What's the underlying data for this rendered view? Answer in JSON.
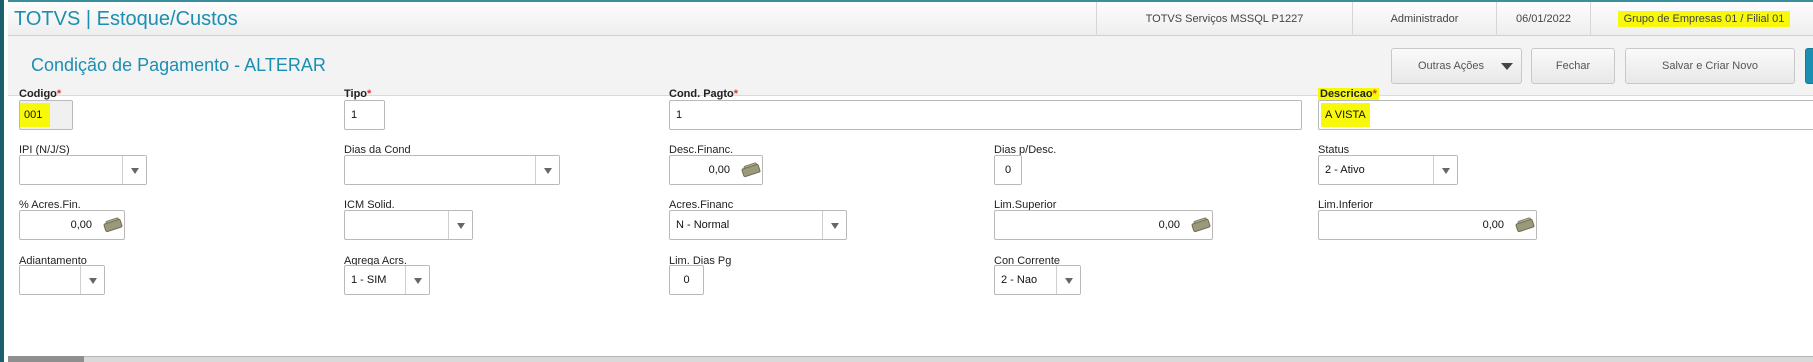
{
  "app": {
    "title": "TOTVS | Estoque/Custos",
    "server": "TOTVS Serviços MSSQL P1227",
    "user": "Administrador",
    "date": "06/01/2022",
    "group": "Grupo de Empresas 01 / Filial 01"
  },
  "header": {
    "title": "Condição de Pagamento - ALTERAR",
    "buttons": {
      "outras": "Outras Ações",
      "fechar": "Fechar",
      "salvar": "Salvar e Criar Novo"
    }
  },
  "required_mark": "*",
  "fields": {
    "codigo": {
      "label": "Codigo",
      "value": "001"
    },
    "tipo": {
      "label": "Tipo",
      "value": "1"
    },
    "cond_pagto": {
      "label": "Cond. Pagto",
      "value": "1"
    },
    "descricao": {
      "label": "Descricao",
      "value": "A VISTA"
    },
    "ipi": {
      "label": "IPI (N/J/S)",
      "value": ""
    },
    "dias_cond": {
      "label": "Dias da Cond",
      "value": ""
    },
    "desc_financ": {
      "label": "Desc.Financ.",
      "value": "0,00"
    },
    "dias_desc": {
      "label": "Dias p/Desc.",
      "value": "0"
    },
    "status": {
      "label": "Status",
      "value": "2 - Ativo"
    },
    "acres_fin_pct": {
      "label": "% Acres.Fin.",
      "value": "0,00"
    },
    "icm_solid": {
      "label": "ICM Solid.",
      "value": ""
    },
    "acres_financ": {
      "label": "Acres.Financ",
      "value": "N - Normal"
    },
    "lim_superior": {
      "label": "Lim.Superior",
      "value": "0,00"
    },
    "lim_inferior": {
      "label": "Lim.Inferior",
      "value": "0,00"
    },
    "adiantamento": {
      "label": "Adiantamento",
      "value": ""
    },
    "agrega_acrs": {
      "label": "Agrega Acrs.",
      "value": "1 - SIM"
    },
    "lim_dias_pg": {
      "label": "Lim. Dias Pg",
      "value": "0"
    },
    "con_corrente": {
      "label": "Con Corrente",
      "value": "2 - Nao"
    }
  },
  "colors": {
    "accent": "#1b8fb1",
    "highlight": "#f7f80a",
    "required": "#e0342f"
  }
}
